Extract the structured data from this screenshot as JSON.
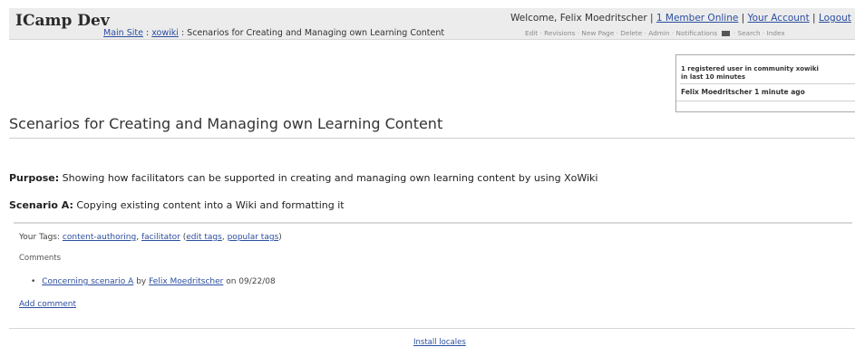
{
  "header": {
    "site_title": "ICamp Dev",
    "breadcrumb": {
      "main_site": "Main Site",
      "sep1": ":",
      "wiki": "xowiki",
      "sep2": ":",
      "current": "Scenarios for Creating and Managing own Learning Content"
    },
    "welcome": {
      "prefix": "Welcome, Felix Moedritscher",
      "sep": "|",
      "members_online": "1 Member Online",
      "your_account": "Your Account",
      "logout": "Logout"
    },
    "toolbar": {
      "edit": "Edit",
      "revisions": "Revisions",
      "new_page": "New Page",
      "delete": "Delete",
      "admin": "Admin",
      "notifications": "Notifications",
      "search": "Search",
      "index": "Index",
      "sep": "·"
    }
  },
  "online_box": {
    "line1": "1 registered user in community xowiki",
    "line2": "in last 10 minutes",
    "user": "Felix Moedritscher 1 minute ago"
  },
  "page": {
    "title": "Scenarios for Creating and Managing own Learning Content",
    "purpose_label": "Purpose:",
    "purpose_text": "Showing how facilitators can be supported in creating and managing own learning content by using XoWiki",
    "scenario_label": "Scenario A:",
    "scenario_text": "Copying existing content into a Wiki and formatting it"
  },
  "tags": {
    "label": "Your Tags:",
    "tag1": "content-authoring",
    "comma": ",",
    "tag2": "facilitator",
    "open_paren": "(",
    "edit_tags": "edit tags",
    "popular_tags": "popular tags",
    "close_paren": ")"
  },
  "comments": {
    "label": "Comments",
    "items": [
      {
        "title": "Concerning scenario A",
        "by": "by",
        "author": "Felix Moedritscher",
        "on": "on 09/22/08"
      }
    ],
    "add_comment": "Add comment"
  },
  "footer": {
    "install_locales": "Install locales"
  }
}
